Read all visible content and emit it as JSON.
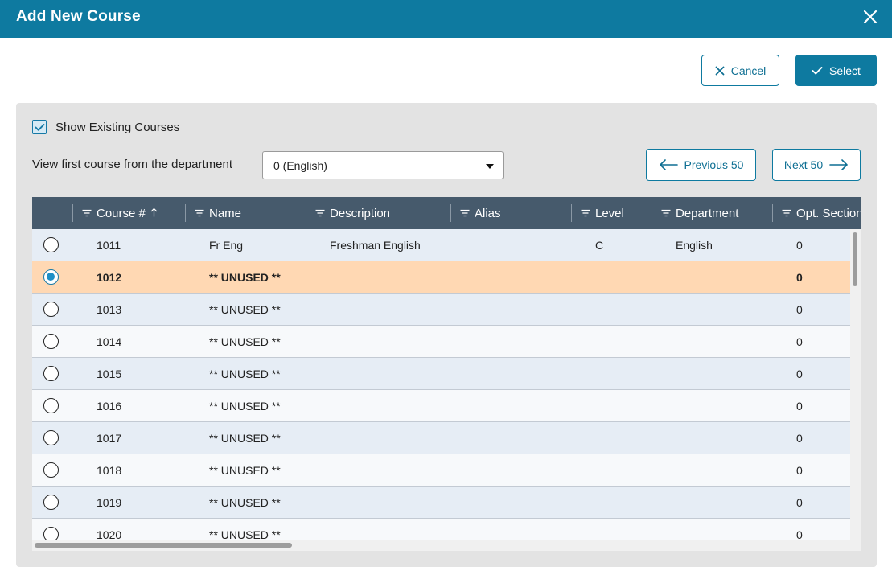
{
  "dialog": {
    "title": "Add New Course",
    "close_icon": "close-icon"
  },
  "actions": {
    "cancel_label": "Cancel",
    "select_label": "Select"
  },
  "filters": {
    "show_existing_label": "Show Existing Courses",
    "show_existing_checked": true,
    "department_label": "View first course from the department",
    "department_value": "0 (English)",
    "prev_label": "Previous 50",
    "next_label": "Next 50"
  },
  "grid": {
    "columns": [
      {
        "key": "course",
        "label": "Course #",
        "sorted": "ascending"
      },
      {
        "key": "name",
        "label": "Name"
      },
      {
        "key": "description",
        "label": "Description"
      },
      {
        "key": "alias",
        "label": "Alias"
      },
      {
        "key": "level",
        "label": "Level"
      },
      {
        "key": "department",
        "label": "Department"
      },
      {
        "key": "opt_sections",
        "label": "Opt. Section"
      }
    ],
    "rows": [
      {
        "course": "1011",
        "name": "Fr Eng",
        "description": "Freshman English",
        "alias": "",
        "level": "C",
        "department": "English",
        "opt_sections": "0",
        "selected": false
      },
      {
        "course": "1012",
        "name": "** UNUSED **",
        "description": "",
        "alias": "",
        "level": "",
        "department": "",
        "opt_sections": "0",
        "selected": true
      },
      {
        "course": "1013",
        "name": "** UNUSED **",
        "description": "",
        "alias": "",
        "level": "",
        "department": "",
        "opt_sections": "0",
        "selected": false
      },
      {
        "course": "1014",
        "name": "** UNUSED **",
        "description": "",
        "alias": "",
        "level": "",
        "department": "",
        "opt_sections": "0",
        "selected": false
      },
      {
        "course": "1015",
        "name": "** UNUSED **",
        "description": "",
        "alias": "",
        "level": "",
        "department": "",
        "opt_sections": "0",
        "selected": false
      },
      {
        "course": "1016",
        "name": "** UNUSED **",
        "description": "",
        "alias": "",
        "level": "",
        "department": "",
        "opt_sections": "0",
        "selected": false
      },
      {
        "course": "1017",
        "name": "** UNUSED **",
        "description": "",
        "alias": "",
        "level": "",
        "department": "",
        "opt_sections": "0",
        "selected": false
      },
      {
        "course": "1018",
        "name": "** UNUSED **",
        "description": "",
        "alias": "",
        "level": "",
        "department": "",
        "opt_sections": "0",
        "selected": false
      },
      {
        "course": "1019",
        "name": "** UNUSED **",
        "description": "",
        "alias": "",
        "level": "",
        "department": "",
        "opt_sections": "0",
        "selected": false
      },
      {
        "course": "1020",
        "name": "** UNUSED **",
        "description": "",
        "alias": "",
        "level": "",
        "department": "",
        "opt_sections": "0",
        "selected": false
      }
    ]
  },
  "colors": {
    "header_bar": "#0e7aa0",
    "grid_header": "#465a6c",
    "row_alt": "#e6edf5",
    "row_selected": "#ffd8b3",
    "panel": "#e3e3e3"
  }
}
